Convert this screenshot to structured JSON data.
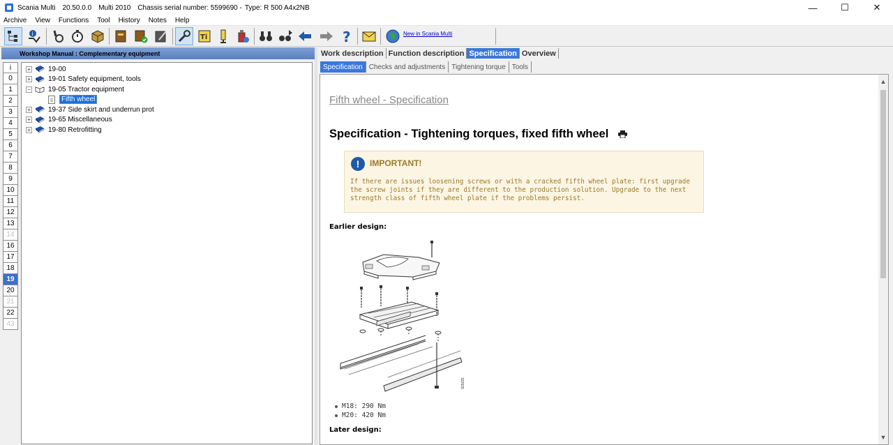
{
  "titlebar": {
    "app_name": "Scania Multi",
    "version": "20.50.0.0",
    "edition": "Multi 2010",
    "chassis": "Chassis serial number: 5599690 -",
    "type": "Type: R 500 A4x2NB",
    "min_glyph": "—",
    "max_glyph": "☐",
    "close_glyph": "✕"
  },
  "menu": [
    "Archive",
    "View",
    "Functions",
    "Tool",
    "History",
    "Notes",
    "Help"
  ],
  "toolbar": {
    "link_text": "New in Scania Multi"
  },
  "left": {
    "header": "Workshop Manual : Complementary equipment",
    "numbers": [
      {
        "label": "i",
        "state": "normal"
      },
      {
        "label": "0",
        "state": "normal"
      },
      {
        "label": "1",
        "state": "normal"
      },
      {
        "label": "2",
        "state": "normal"
      },
      {
        "label": "3",
        "state": "normal"
      },
      {
        "label": "4",
        "state": "normal"
      },
      {
        "label": "5",
        "state": "normal"
      },
      {
        "label": "6",
        "state": "normal"
      },
      {
        "label": "7",
        "state": "normal"
      },
      {
        "label": "8",
        "state": "normal"
      },
      {
        "label": "9",
        "state": "normal"
      },
      {
        "label": "10",
        "state": "normal"
      },
      {
        "label": "11",
        "state": "normal"
      },
      {
        "label": "12",
        "state": "normal"
      },
      {
        "label": "13",
        "state": "normal"
      },
      {
        "label": "14",
        "state": "dis"
      },
      {
        "label": "16",
        "state": "normal"
      },
      {
        "label": "17",
        "state": "normal"
      },
      {
        "label": "18",
        "state": "normal"
      },
      {
        "label": "19",
        "state": "sel"
      },
      {
        "label": "20",
        "state": "normal"
      },
      {
        "label": "21",
        "state": "dis"
      },
      {
        "label": "22",
        "state": "normal"
      },
      {
        "label": "43",
        "state": "dis"
      }
    ],
    "tree": [
      {
        "label": "19-00"
      },
      {
        "label": "19-01 Safety equipment, tools"
      },
      {
        "label": "19-05 Tractor equipment"
      },
      {
        "label": "Fifth wheel"
      },
      {
        "label": "19-37 Side skirt and underrun prot"
      },
      {
        "label": "19-65 Miscellaneous"
      },
      {
        "label": "19-80 Retrofitting"
      }
    ]
  },
  "right": {
    "tabs": [
      "Work description",
      "Function description",
      "Specification",
      "Overview"
    ],
    "subtabs": [
      "Specification",
      "Checks and adjustments",
      "Tightening torque",
      "Tools"
    ],
    "doc": {
      "heading": "Fifth wheel - Specification",
      "title": "Specification - Tightening torques, fixed fifth wheel",
      "note_title": "IMPORTANT!",
      "note_text": "If there are issues loosening screws or with a cracked fifth wheel plate: first upgrade the screw joints if they are different to the production solution. Upgrade to the next strength class of fifth wheel plate if the problems persist.",
      "earlier_label": "Earlier design:",
      "figure_number": "322629",
      "bullets": [
        "M18: 290 Nm",
        "M20: 420 Nm"
      ],
      "later_label": "Later design:"
    }
  }
}
